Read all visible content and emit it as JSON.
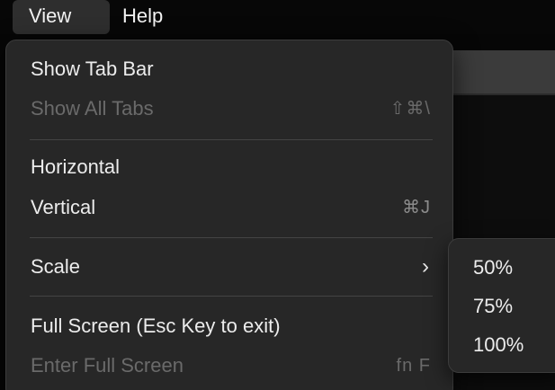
{
  "menubar": {
    "items": [
      {
        "label": "View"
      },
      {
        "label": "Help"
      }
    ]
  },
  "view_menu": {
    "items": [
      {
        "label": "Show Tab Bar",
        "shortcut": "",
        "enabled": true
      },
      {
        "label": "Show All Tabs",
        "shortcut": "⇧⌘\\",
        "enabled": false
      },
      {
        "label": "Horizontal",
        "shortcut": "",
        "enabled": true
      },
      {
        "label": "Vertical",
        "shortcut": "⌘J",
        "enabled": true
      },
      {
        "label": "Scale",
        "submenu_indicator": "›",
        "enabled": true
      },
      {
        "label": "Full Screen (Esc Key to exit)",
        "shortcut": "",
        "enabled": true
      },
      {
        "label": "Enter Full Screen",
        "shortcut": "fn F",
        "enabled": false
      }
    ]
  },
  "scale_submenu": {
    "items": [
      {
        "label": "50%"
      },
      {
        "label": "75%"
      },
      {
        "label": "100%"
      }
    ]
  },
  "colors": {
    "menu_bg": "#272727",
    "text": "#ececec",
    "disabled_text": "#6a6a6a",
    "shortcut_text": "#8c8c8c"
  }
}
